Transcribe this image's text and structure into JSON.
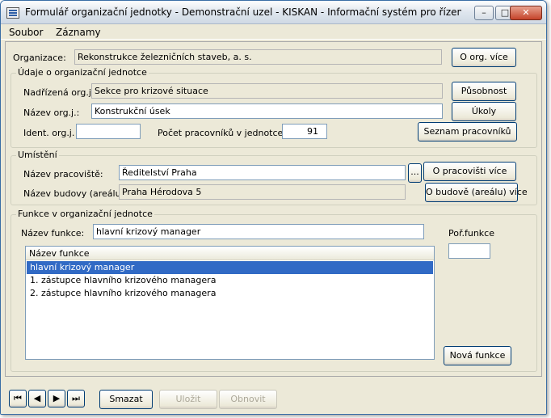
{
  "window": {
    "title": "Formulář organizační jednotky - Demonstrační uzel - KISKAN - Informační systém pro řízení krizovýc...",
    "controls": {
      "minimize": "–",
      "maximize": "□",
      "close": "✕"
    }
  },
  "menu": [
    "Soubor",
    "Záznamy"
  ],
  "organization": {
    "label": "Organizace:",
    "value": "Rekonstrukce železničních staveb, a. s.",
    "button": "O org. více"
  },
  "unit": {
    "legend": "Údaje o organizační jednotce",
    "parent_label": "Nadřízená org.j.",
    "parent_value": "Sekce pro krizové situace",
    "parent_button": "Působnost",
    "name_label": "Název org.j.:",
    "name_value": "Konstrukční úsek",
    "name_button": "Úkoly",
    "ident_label": "Ident. org.j.",
    "ident_value": "",
    "staff_count_label": "Počet pracovníků v jednotce:",
    "staff_count_value": "91",
    "staff_button": "Seznam pracovníků"
  },
  "location": {
    "legend": "Umístění",
    "workplace_label": "Název pracoviště:",
    "workplace_value": "Ředitelství Praha",
    "browse_button": "...",
    "workplace_button": "O pracovišti více",
    "building_label": "Název budovy (areálu):",
    "building_value": "Praha Hérodova 5",
    "building_button": "O budově (areálu) více"
  },
  "functions": {
    "legend": "Funkce v organizační jednotce",
    "name_label": "Název funkce:",
    "name_value": "hlavní krizový manager",
    "order_label": "Poř.funkce",
    "order_value": "",
    "list_header": "Název funkce",
    "items": [
      {
        "label": "hlavní krizový manager",
        "selected": true
      },
      {
        "label": "1. zástupce hlavního krizového managera",
        "selected": false
      },
      {
        "label": "2. zástupce hlavního krizového managera",
        "selected": false
      }
    ],
    "new_button": "Nová funkce"
  },
  "footer": {
    "nav": {
      "first": "⏮",
      "prev": "◀",
      "next": "▶",
      "last": "⏭"
    },
    "delete_button": "Smazat",
    "save_button": "Uložit",
    "restore_button": "Obnovit"
  },
  "colors": {
    "selection": "#316ac5",
    "window_border": "#3a6ea5",
    "face": "#ece9d8"
  }
}
